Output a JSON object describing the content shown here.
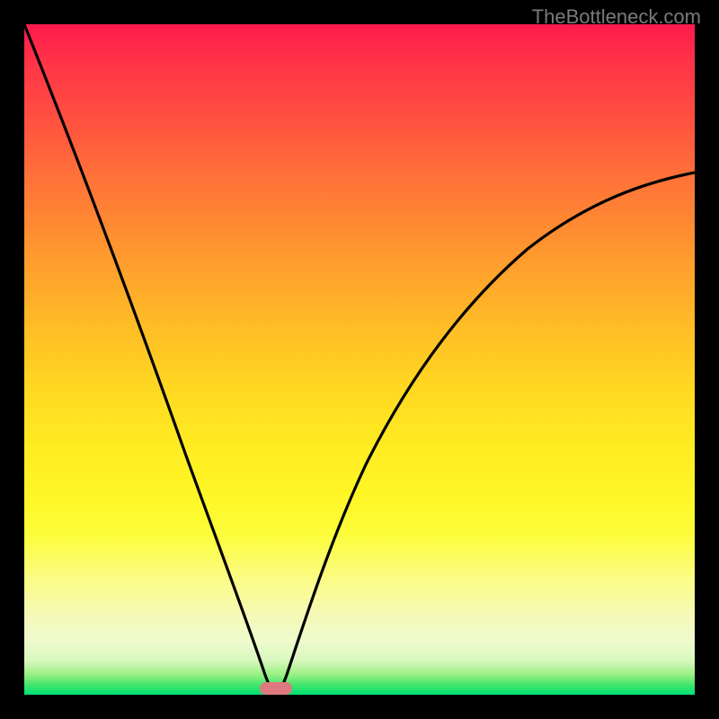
{
  "watermark": "TheBottleneck.com",
  "chart_data": {
    "type": "line",
    "title": "",
    "xlabel": "",
    "ylabel": "",
    "xlim": [
      0,
      100
    ],
    "ylim": [
      0,
      100
    ],
    "x_optimal": 37.5,
    "series": [
      {
        "name": "left-curve",
        "x": [
          0,
          4,
          8,
          12,
          16,
          20,
          24,
          28,
          31,
          34,
          36,
          37.5
        ],
        "y": [
          100,
          90,
          80,
          70,
          60,
          49,
          38,
          27,
          18,
          10,
          4,
          0
        ]
      },
      {
        "name": "right-curve",
        "x": [
          37.5,
          39,
          42,
          46,
          51,
          57,
          64,
          72,
          80,
          88,
          95,
          100
        ],
        "y": [
          0,
          4,
          12,
          22,
          33,
          43,
          52,
          60,
          66,
          71,
          75,
          78
        ]
      }
    ],
    "marker": {
      "x": 37.5,
      "y": 0,
      "color": "#de7a7f"
    },
    "gradient_stops": [
      {
        "pos": 0,
        "color": "#ff1a4d"
      },
      {
        "pos": 50,
        "color": "#ffd722"
      },
      {
        "pos": 80,
        "color": "#fdfd3a"
      },
      {
        "pos": 100,
        "color": "#00e074"
      }
    ]
  }
}
